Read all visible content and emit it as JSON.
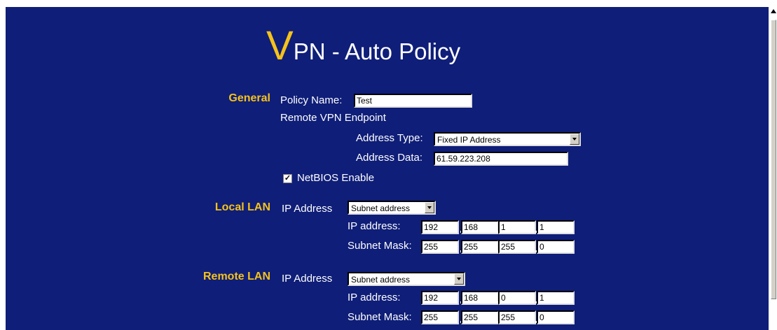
{
  "title": {
    "first_letter": "V",
    "rest": "PN - Auto Policy"
  },
  "general": {
    "section_label": "General",
    "policy_name_label": "Policy Name:",
    "policy_name_value": "Test",
    "remote_endpoint_label": "Remote VPN Endpoint",
    "address_type_label": "Address Type:",
    "address_type_value": "Fixed IP Address",
    "address_data_label": "Address Data:",
    "address_data_value": "61.59.223.208",
    "netbios_label": "NetBIOS Enable",
    "netbios_checked": true
  },
  "local_lan": {
    "section_label": "Local LAN",
    "ip_address_label": "IP Address",
    "ip_mode_value": "Subnet address",
    "ip_label": "IP address:",
    "ip_octets": [
      "192",
      "168",
      "1",
      "1"
    ],
    "mask_label": "Subnet Mask:",
    "mask_octets": [
      "255",
      "255",
      "255",
      "0"
    ]
  },
  "remote_lan": {
    "section_label": "Remote LAN",
    "ip_address_label": "IP Address",
    "ip_mode_value": "Subnet address",
    "ip_label": "IP address:",
    "ip_octets": [
      "192",
      "168",
      "0",
      "1"
    ],
    "mask_label": "Subnet Mask:",
    "mask_octets": [
      "255",
      "255",
      "255",
      "0"
    ]
  },
  "colors": {
    "background": "#0f1e78",
    "accent": "#f5c21b",
    "text": "#ffffff"
  }
}
